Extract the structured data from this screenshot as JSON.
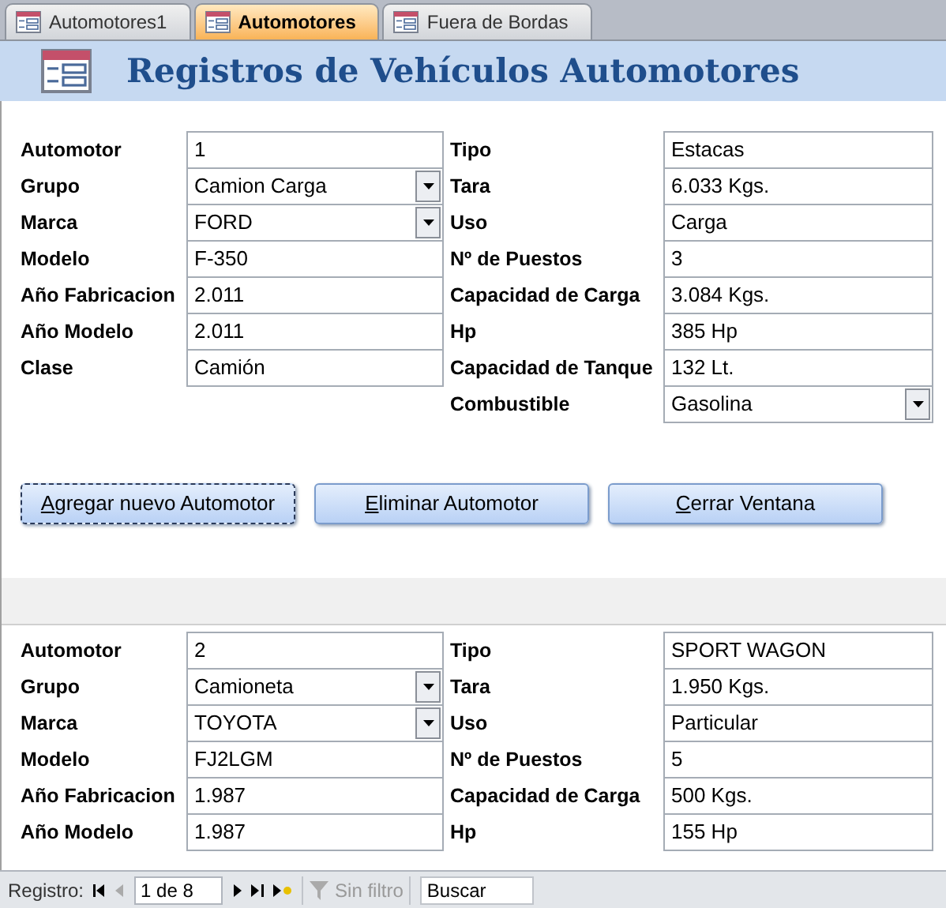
{
  "tabs": [
    {
      "label": "Automotores1",
      "selected": false
    },
    {
      "label": "Automotores",
      "selected": true
    },
    {
      "label": "Fuera de Bordas",
      "selected": false
    }
  ],
  "header": {
    "title": "Registros de Vehículos Automotores"
  },
  "records": [
    {
      "left": [
        {
          "label": "Automotor",
          "value": "1",
          "kind": "text"
        },
        {
          "label": "Grupo",
          "value": "Camion Carga",
          "kind": "combo"
        },
        {
          "label": "Marca",
          "value": "FORD",
          "kind": "combo"
        },
        {
          "label": "Modelo",
          "value": "F-350",
          "kind": "text"
        },
        {
          "label": "Año Fabricacion",
          "value": "2.011",
          "kind": "text"
        },
        {
          "label": "Año Modelo",
          "value": "2.011",
          "kind": "text"
        },
        {
          "label": "Clase",
          "value": "Camión",
          "kind": "text"
        }
      ],
      "right": [
        {
          "label": "Tipo",
          "value": "Estacas",
          "kind": "text"
        },
        {
          "label": "Tara",
          "value": "6.033 Kgs.",
          "kind": "text"
        },
        {
          "label": "Uso",
          "value": "Carga",
          "kind": "text"
        },
        {
          "label": "Nº de Puestos",
          "value": "3",
          "kind": "text"
        },
        {
          "label": "Capacidad de Carga",
          "value": "3.084 Kgs.",
          "kind": "text"
        },
        {
          "label": "Hp",
          "value": "385 Hp",
          "kind": "text"
        },
        {
          "label": "Capacidad de Tanque",
          "value": "132 Lt.",
          "kind": "text"
        },
        {
          "label": "Combustible",
          "value": "Gasolina",
          "kind": "combo"
        }
      ],
      "buttons": [
        {
          "key": "A",
          "rest": "gregar nuevo Automotor",
          "focused": true
        },
        {
          "key": "E",
          "rest": "liminar Automotor",
          "focused": false
        },
        {
          "key": "C",
          "rest": "errar Ventana",
          "focused": false
        }
      ]
    },
    {
      "left": [
        {
          "label": "Automotor",
          "value": "2",
          "kind": "text"
        },
        {
          "label": "Grupo",
          "value": "Camioneta",
          "kind": "combo"
        },
        {
          "label": "Marca",
          "value": "TOYOTA",
          "kind": "combo"
        },
        {
          "label": "Modelo",
          "value": "FJ2LGM",
          "kind": "text"
        },
        {
          "label": "Año Fabricacion",
          "value": "1.987",
          "kind": "text"
        },
        {
          "label": "Año Modelo",
          "value": "1.987",
          "kind": "text"
        }
      ],
      "right": [
        {
          "label": "Tipo",
          "value": "SPORT WAGON",
          "kind": "text"
        },
        {
          "label": "Tara",
          "value": "1.950 Kgs.",
          "kind": "text"
        },
        {
          "label": "Uso",
          "value": "Particular",
          "kind": "text"
        },
        {
          "label": "Nº de Puestos",
          "value": "5",
          "kind": "text"
        },
        {
          "label": "Capacidad de Carga",
          "value": "500 Kgs.",
          "kind": "text"
        },
        {
          "label": "Hp",
          "value": "155 Hp",
          "kind": "text"
        }
      ]
    }
  ],
  "status_bar": {
    "label": "Registro:",
    "position": "1 de 8",
    "filter": "Sin filtro",
    "search_placeholder": "Buscar"
  }
}
